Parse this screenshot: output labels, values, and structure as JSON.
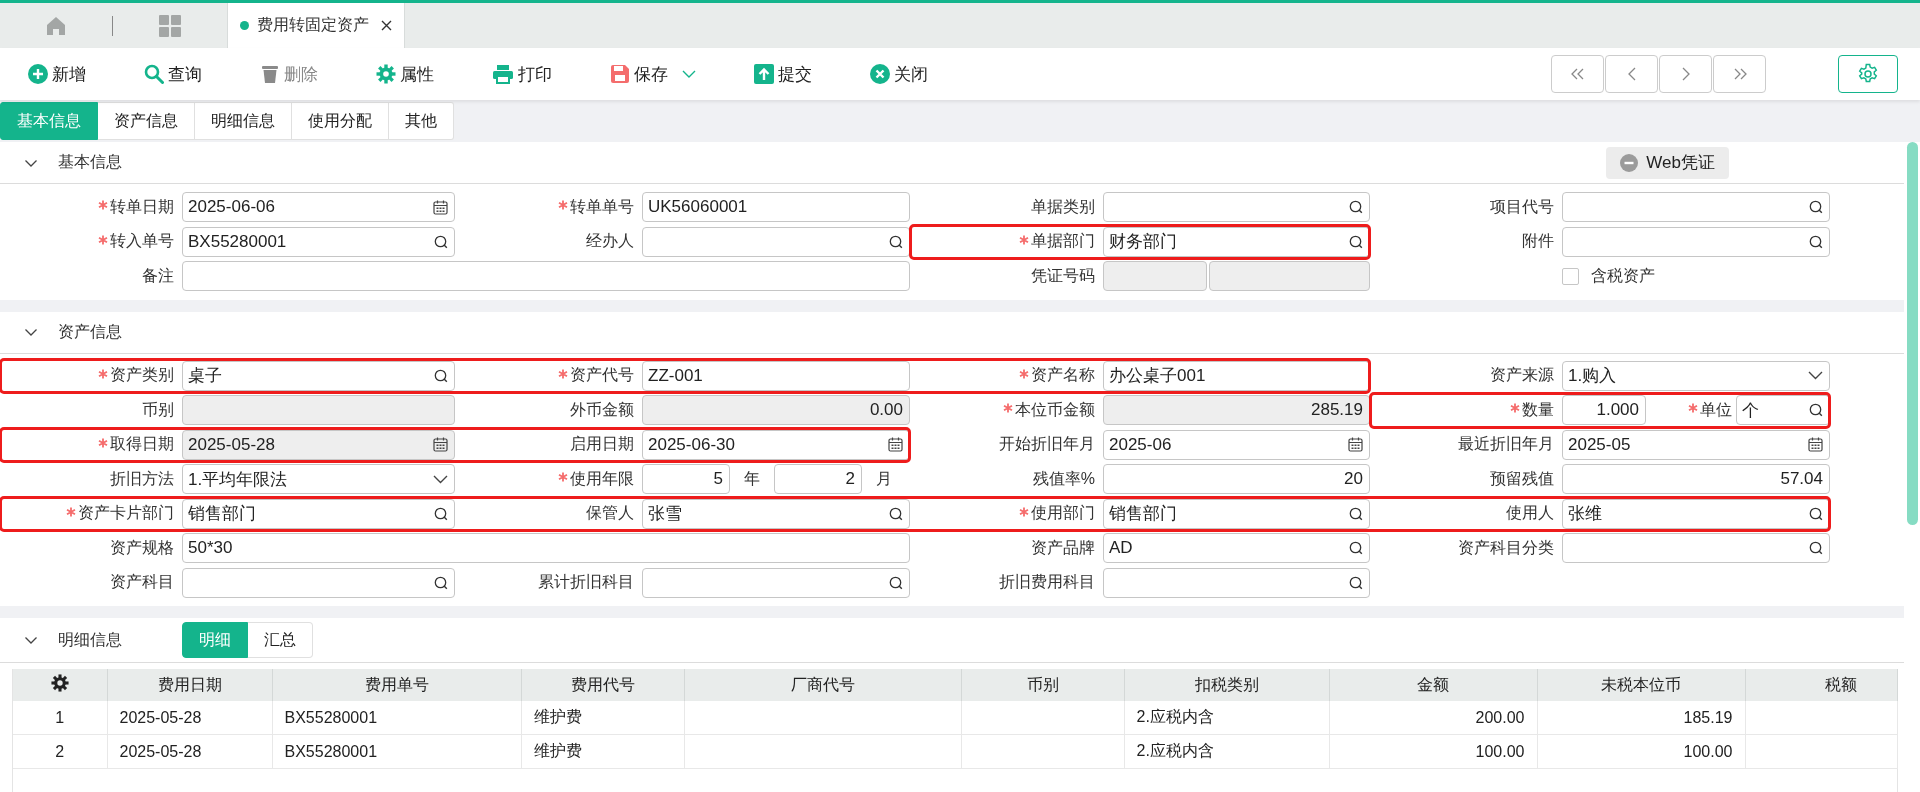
{
  "doc_tabs": [
    {
      "label": "费用转固定资产",
      "selected": true
    }
  ],
  "toolbar": [
    {
      "kind": "new",
      "label": "新增",
      "disabled": false,
      "dropdown": false
    },
    {
      "kind": "query",
      "label": "查询",
      "disabled": false,
      "dropdown": false
    },
    {
      "kind": "delete",
      "label": "删除",
      "disabled": true,
      "dropdown": false
    },
    {
      "kind": "properties",
      "label": "属性",
      "disabled": false,
      "dropdown": false
    },
    {
      "kind": "print",
      "label": "打印",
      "disabled": false,
      "dropdown": false
    },
    {
      "kind": "save",
      "label": "保存",
      "disabled": false,
      "dropdown": true
    },
    {
      "kind": "submit",
      "label": "提交",
      "disabled": false,
      "dropdown": false
    },
    {
      "kind": "close",
      "label": "关闭",
      "disabled": false,
      "dropdown": false
    }
  ],
  "page_tabs": [
    {
      "label": "基本信息",
      "selected": true
    },
    {
      "label": "资产信息",
      "selected": false
    },
    {
      "label": "明细信息",
      "selected": false
    },
    {
      "label": "使用分配",
      "selected": false
    },
    {
      "label": "其他",
      "selected": false
    }
  ],
  "basic_info": {
    "title": "基本信息",
    "expanded": true,
    "voucher_button": "Web凭证",
    "rows": [
      [
        {
          "kind": "date",
          "label": "转单日期",
          "required": true,
          "value": "2025-06-06",
          "disabled": false,
          "highlighted": false
        },
        {
          "kind": "text",
          "label": "转单单号",
          "required": true,
          "value": "UK56060001",
          "disabled": false,
          "highlighted": false
        },
        {
          "kind": "lookup",
          "label": "单据类别",
          "required": false,
          "disabled": false,
          "highlighted": false
        },
        {
          "kind": "lookup",
          "label": "项目代号",
          "required": false,
          "disabled": false,
          "highlighted": false
        }
      ],
      [
        {
          "kind": "lookup",
          "label": "转入单号",
          "required": true,
          "value": "BX55280001",
          "disabled": false,
          "highlighted": false
        },
        {
          "kind": "lookup",
          "label": "经办人",
          "required": false,
          "disabled": false,
          "highlighted": false
        },
        {
          "kind": "lookup",
          "label": "单据部门",
          "required": true,
          "value": "财务部门",
          "disabled": false,
          "highlighted": true
        },
        {
          "kind": "lookup",
          "label": "附件",
          "required": false,
          "disabled": false,
          "highlighted": false
        }
      ],
      [
        {
          "kind": "wide-text",
          "label": "备注",
          "required": false,
          "disabled": false,
          "highlighted": false
        },
        {
          "kind": "covered"
        },
        {
          "kind": "voucher",
          "label": "凭证号码",
          "required": false,
          "disabled": true,
          "highlighted": false
        },
        {
          "kind": "checkbox",
          "label": "含税资产",
          "checked": false,
          "highlighted": false
        }
      ]
    ]
  },
  "asset_info": {
    "title": "资产信息",
    "expanded": true,
    "rows": [
      [
        {
          "kind": "lookup",
          "label": "资产类别",
          "required": true,
          "value": "桌子",
          "disabled": false,
          "highlighted": true
        },
        {
          "kind": "text",
          "label": "资产代号",
          "required": true,
          "value": "ZZ-001",
          "disabled": false,
          "highlighted": true
        },
        {
          "kind": "text",
          "label": "资产名称",
          "required": true,
          "value": "办公桌子001",
          "disabled": false,
          "highlighted": true
        },
        {
          "kind": "select",
          "label": "资产来源",
          "required": false,
          "value": "1.购入",
          "disabled": false,
          "highlighted": false
        }
      ],
      [
        {
          "kind": "text",
          "label": "币别",
          "required": false,
          "disabled": true,
          "highlighted": false
        },
        {
          "kind": "number",
          "label": "外币金额",
          "required": false,
          "value": "0.00",
          "disabled": true,
          "highlighted": false
        },
        {
          "kind": "number",
          "label": "本位币金额",
          "required": true,
          "value": "285.19",
          "disabled": true,
          "highlighted": false
        },
        {
          "kind": "quantity-unit",
          "label": "数量",
          "required": true,
          "value": "1.000",
          "unit_label": "单位",
          "unit_required": true,
          "unit_value": "个",
          "highlighted": true
        }
      ],
      [
        {
          "kind": "date",
          "label": "取得日期",
          "required": true,
          "value": "2025-05-28",
          "disabled": true,
          "highlighted": true
        },
        {
          "kind": "date",
          "label": "启用日期",
          "required": false,
          "value": "2025-06-30",
          "disabled": false,
          "highlighted": true
        },
        {
          "kind": "date",
          "label": "开始折旧年月",
          "required": false,
          "value": "2025-06",
          "disabled": false,
          "highlighted": false
        },
        {
          "kind": "date",
          "label": "最近折旧年月",
          "required": false,
          "value": "2025-05",
          "disabled": false,
          "highlighted": false
        }
      ],
      [
        {
          "kind": "select",
          "label": "折旧方法",
          "required": false,
          "value": "1.平均年限法",
          "disabled": false,
          "highlighted": false
        },
        {
          "kind": "term",
          "label": "使用年限",
          "required": true,
          "years": "5",
          "years_unit": "年",
          "months": "2",
          "months_unit": "月",
          "highlighted": false
        },
        {
          "kind": "number",
          "label": "残值率%",
          "required": false,
          "value": "20",
          "disabled": false,
          "highlighted": false
        },
        {
          "kind": "number",
          "label": "预留残值",
          "required": false,
          "value": "57.04",
          "disabled": false,
          "highlighted": false
        }
      ],
      [
        {
          "kind": "lookup",
          "label": "资产卡片部门",
          "required": true,
          "value": "销售部门",
          "disabled": false,
          "highlighted": true
        },
        {
          "kind": "lookup",
          "label": "保管人",
          "required": false,
          "value": "张雪",
          "disabled": false,
          "highlighted": true
        },
        {
          "kind": "lookup",
          "label": "使用部门",
          "required": true,
          "value": "销售部门",
          "disabled": false,
          "highlighted": true
        },
        {
          "kind": "lookup",
          "label": "使用人",
          "required": false,
          "value": "张维",
          "disabled": false,
          "highlighted": true
        }
      ],
      [
        {
          "kind": "wide-text",
          "label": "资产规格",
          "required": false,
          "value": "50*30",
          "disabled": false,
          "highlighted": false
        },
        {
          "kind": "covered"
        },
        {
          "kind": "lookup",
          "label": "资产品牌",
          "required": false,
          "value": "AD",
          "disabled": false,
          "highlighted": false
        },
        {
          "kind": "lookup",
          "label": "资产科目分类",
          "required": false,
          "disabled": false,
          "highlighted": false
        }
      ],
      [
        {
          "kind": "lookup",
          "label": "资产科目",
          "required": false,
          "disabled": false,
          "highlighted": false
        },
        {
          "kind": "lookup",
          "label": "累计折旧科目",
          "required": false,
          "disabled": false,
          "highlighted": false
        },
        {
          "kind": "lookup",
          "label": "折旧费用科目",
          "required": false,
          "disabled": false,
          "highlighted": false
        },
        {
          "kind": "empty"
        }
      ]
    ]
  },
  "detail_info": {
    "title": "明细信息",
    "expanded": true,
    "view_tabs": [
      {
        "label": "明细",
        "selected": true
      },
      {
        "label": "汇总",
        "selected": false
      }
    ],
    "table": {
      "columns": [
        {
          "kind": "settings"
        },
        {
          "kind": "text",
          "label": "费用日期"
        },
        {
          "kind": "text",
          "label": "费用单号"
        },
        {
          "kind": "text",
          "label": "费用代号"
        },
        {
          "kind": "text",
          "label": "厂商代号"
        },
        {
          "kind": "text",
          "label": "币别"
        },
        {
          "kind": "text",
          "label": "扣税类别"
        },
        {
          "kind": "number",
          "label": "金额"
        },
        {
          "kind": "number",
          "label": "未税本位币"
        },
        {
          "kind": "number",
          "label": "税额"
        }
      ],
      "rows": [
        [
          "1",
          "2025-05-28",
          "BX55280001",
          "维护费",
          null,
          null,
          "2.应税内含",
          "200.00",
          "185.19",
          null
        ],
        [
          "2",
          "2025-05-28",
          "BX55280001",
          "维护费",
          null,
          null,
          "2.应税内含",
          "100.00",
          "100.00",
          null
        ]
      ]
    }
  }
}
